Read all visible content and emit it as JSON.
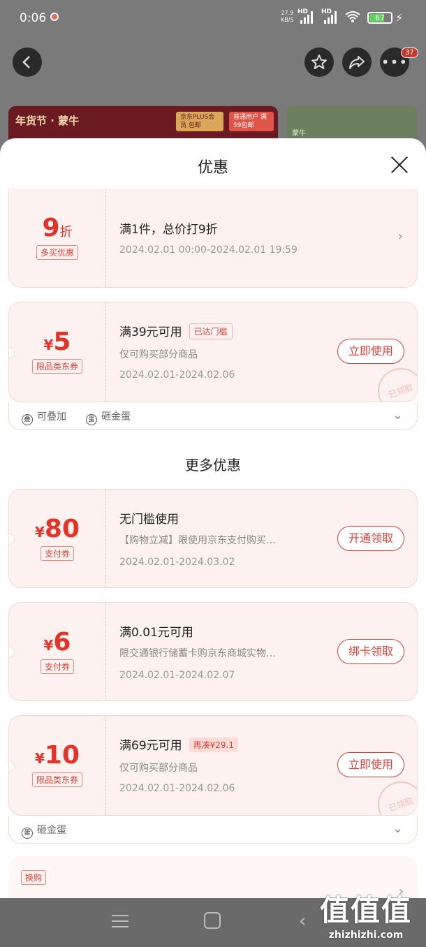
{
  "status_bar": {
    "time": "0:06",
    "net_speed": "27.9",
    "net_unit": "KB/S",
    "hd1": "HD",
    "hd2": "HD",
    "battery": "67"
  },
  "page": {
    "banner_brand": "年货节 · 蒙牛",
    "banner_tag_plus": "京东PLUS会员 包邮",
    "banner_tag_normal": "普通用户 满59包邮",
    "banner2_logo": "蒙牛",
    "more_badge": "37"
  },
  "sheet": {
    "title": "优惠",
    "section_more": "更多优惠"
  },
  "coupons": [
    {
      "amount": "9",
      "unit": "折",
      "tag": "多买优惠",
      "line1": "满1件，总价打9折",
      "line3": "2024.02.01 00:00-2024.02.01 19:59"
    },
    {
      "amount": "5",
      "yen": "¥",
      "tag": "限品类东券",
      "line1": "满39元可用",
      "pill": "已达门槛",
      "line2": "仅可购买部分商品",
      "line3": "2024.02.01-2024.02.06",
      "action": "立即使用",
      "stamp": "已领取",
      "sub_items": [
        "可叠加",
        "砸金蛋"
      ]
    },
    {
      "amount": "80",
      "yen": "¥",
      "tag": "支付券",
      "line1": "无门槛使用",
      "line2": "【购物立减】限使用京东支付购买…",
      "line3": "2024.02.01-2024.03.02",
      "action": "开通领取"
    },
    {
      "amount": "6",
      "yen": "¥",
      "tag": "支付券",
      "line1": "满0.01元可用",
      "line2": "限交通银行储蓄卡购京东商城实物…",
      "line3": "2024.02.01-2024.02.07",
      "action": "绑卡领取"
    },
    {
      "amount": "10",
      "yen": "¥",
      "tag": "限品类东券",
      "line1": "满69元可用",
      "pill": "再凑¥29.1",
      "line2": "仅可购买部分商品",
      "line3": "2024.02.01-2024.02.06",
      "action": "立即使用",
      "stamp": "已领取",
      "sub_items": [
        "砸金蛋"
      ]
    }
  ],
  "last_card": {
    "tag": "换购"
  },
  "watermark": {
    "big": "值值值",
    "small": "zhizhizhi.com"
  }
}
